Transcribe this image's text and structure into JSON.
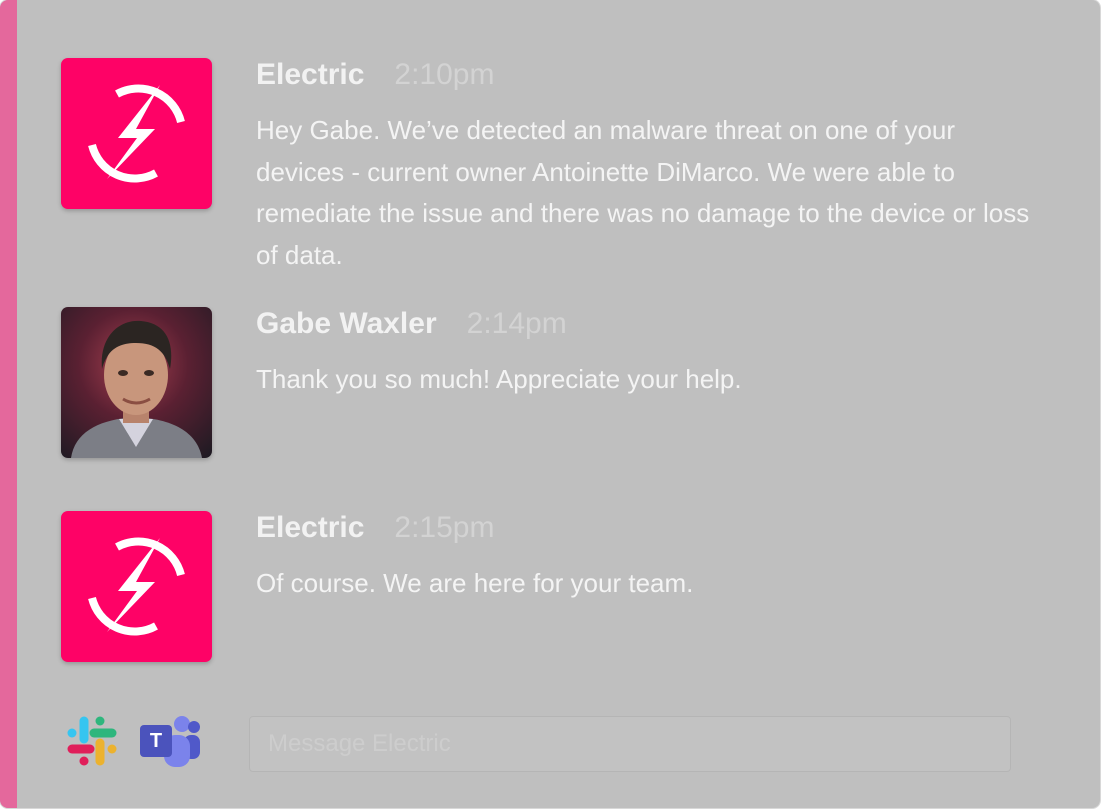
{
  "colors": {
    "accent_bar": "#e4689c",
    "brand": "#fe0266",
    "panel": "#bfbfbf"
  },
  "messages": [
    {
      "sender": "Electric",
      "time": "2:10pm",
      "avatar_icon": "electric-bolt-icon",
      "text": "Hey Gabe. We’ve detected an malware threat on one of your devices - current owner Antoinette DiMarco. We were able to remediate the issue and there was no damage to the device or loss of data."
    },
    {
      "sender": "Gabe Waxler",
      "time": "2:14pm",
      "avatar_icon": "user-photo",
      "text": "Thank you so much! Appreciate your help."
    },
    {
      "sender": "Electric",
      "time": "2:15pm",
      "avatar_icon": "electric-bolt-icon",
      "text": "Of course. We are here for your team."
    }
  ],
  "footer": {
    "icons": [
      "slack-icon",
      "teams-icon"
    ],
    "teams_letter": "T",
    "composer_placeholder": "Message Electric"
  }
}
